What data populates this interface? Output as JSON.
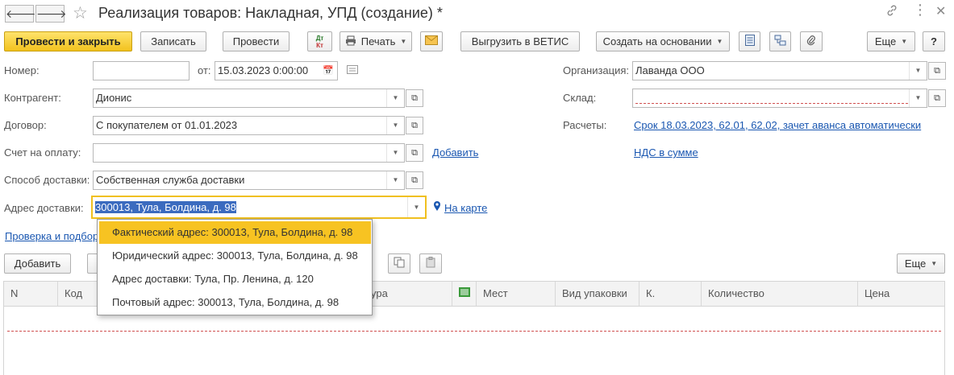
{
  "window": {
    "title": "Реализация товаров: Накладная, УПД (создание) *"
  },
  "toolbar": {
    "post_close": "Провести и закрыть",
    "save": "Записать",
    "post": "Провести",
    "dtkt_top": "Дт",
    "dtkt_bottom": "Кт",
    "print": "Печать",
    "export_vetis": "Выгрузить в ВЕТИС",
    "create_based": "Создать на основании",
    "more": "Еще",
    "help": "?"
  },
  "form": {
    "number_label": "Номер:",
    "number_value": "",
    "date_label": "от:",
    "date_value": "15.03.2023  0:00:00",
    "org_label": "Организация:",
    "org_value": "Лаванда ООО",
    "contractor_label": "Контрагент:",
    "contractor_value": "Дионис",
    "warehouse_label": "Склад:",
    "warehouse_value": "",
    "contract_label": "Договор:",
    "contract_value": "С покупателем от 01.01.2023",
    "settlements_label": "Расчеты:",
    "settlements_link": "Срок 18.03.2023, 62.01, 62.02, зачет аванса автоматически",
    "invoice_label": "Счет на оплату:",
    "invoice_value": "",
    "invoice_add_link": "Добавить",
    "vat_link": "НДС в сумме",
    "delivery_method_label": "Способ доставки:",
    "delivery_method_value": "Собственная служба доставки",
    "delivery_address_label": "Адрес доставки:",
    "delivery_address_value": "300013, Тула, Болдина, д. 98",
    "map_link": "На карте",
    "check_link": "Проверка и подбор"
  },
  "items_toolbar": {
    "add": "Добавить",
    "more": "Еще"
  },
  "table": {
    "columns": [
      "N",
      "Код",
      "ура",
      "Мест",
      "Вид упаковки",
      "К.",
      "Количество",
      "Цена"
    ]
  },
  "address_dropdown": {
    "options": [
      "Фактический адрес: 300013, Тула, Болдина, д. 98",
      "Юридический адрес: 300013, Тула, Болдина, д. 98",
      "Адрес доставки: Тула, Пр. Ленина, д. 120",
      "Почтовый адрес: 300013, Тула, Болдина, д. 98"
    ],
    "selected_index": 0
  },
  "colors": {
    "primary_button": "#f2c21e",
    "link": "#1a57b1",
    "selected_option": "#f7c322",
    "focus_border": "#f0c020"
  }
}
